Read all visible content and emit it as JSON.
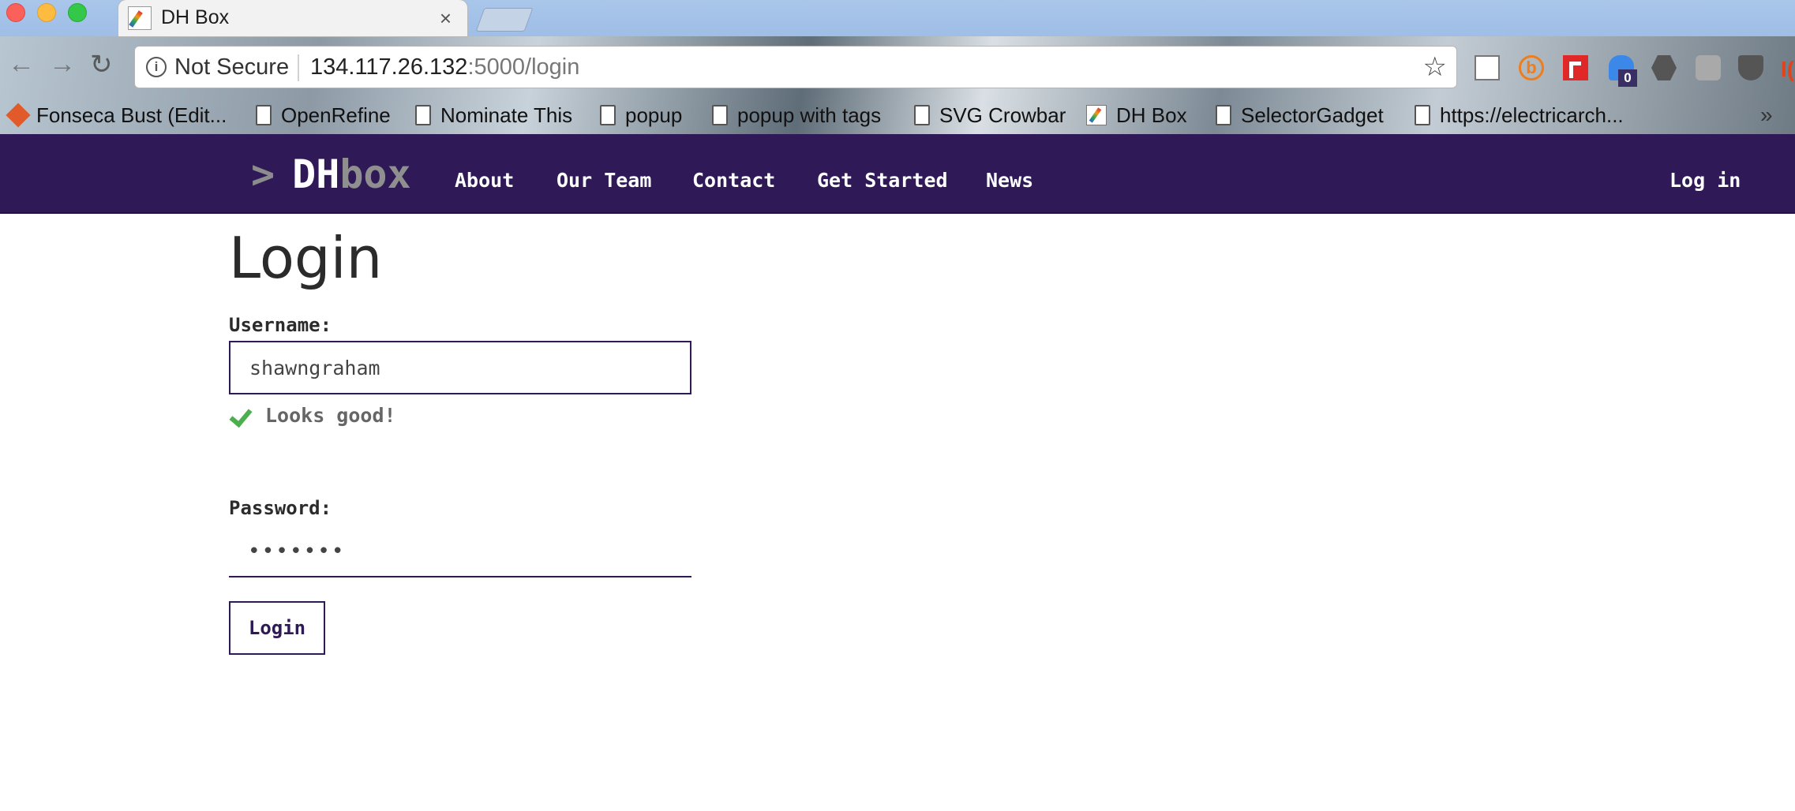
{
  "browser": {
    "tab_title": "DH Box",
    "tab_close": "×",
    "security_label": "Not Secure",
    "info_icon": "i",
    "url_host": "134.117.26.132",
    "url_path": ":5000/login",
    "ext_badge_count": "0",
    "ext_edge_char": "I(",
    "bookmarks": [
      {
        "label": "Fonseca Bust (Edit...",
        "icon": "diamond-icon"
      },
      {
        "label": "OpenRefine",
        "icon": "page-icon"
      },
      {
        "label": "Nominate This",
        "icon": "page-icon"
      },
      {
        "label": "popup",
        "icon": "page-icon"
      },
      {
        "label": "popup with tags",
        "icon": "page-icon"
      },
      {
        "label": "SVG Crowbar",
        "icon": "page-icon"
      },
      {
        "label": "DH Box",
        "icon": "dhbox-favicon-icon"
      },
      {
        "label": "SelectorGadget",
        "icon": "page-icon"
      },
      {
        "label": "https://electricarch...",
        "icon": "page-icon"
      }
    ],
    "bookmarks_overflow": "»"
  },
  "site_nav": {
    "brand_prompt": ">",
    "brand_dh": "DH",
    "brand_box": "box",
    "links": [
      "About",
      "Our Team",
      "Contact",
      "Get Started",
      "News"
    ],
    "login": "Log in"
  },
  "login_form": {
    "title": "Login",
    "username_label": "Username:",
    "username_value": "shawngraham",
    "validation_message": "Looks good!",
    "password_label": "Password:",
    "password_value": "•••••••",
    "submit_label": "Login"
  },
  "colors": {
    "brand_purple": "#2f1a57",
    "valid_green": "#4cae4c"
  }
}
